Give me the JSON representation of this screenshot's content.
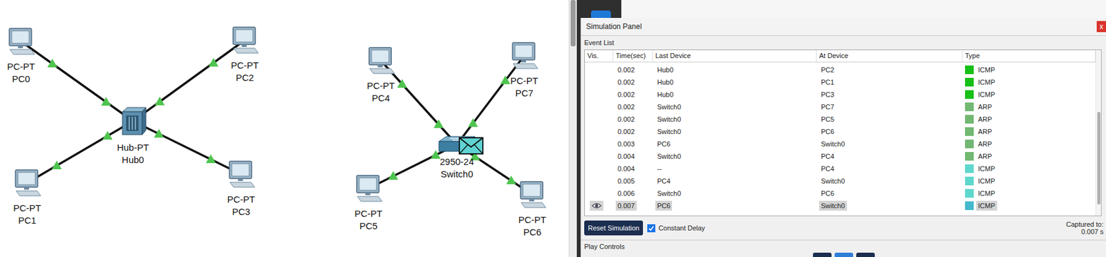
{
  "diagram": {
    "nodes": [
      {
        "name": "PC0",
        "model": "PC-PT",
        "kind": "pc"
      },
      {
        "name": "PC2",
        "model": "PC-PT",
        "kind": "pc"
      },
      {
        "name": "Hub0",
        "model": "Hub-PT",
        "kind": "hub"
      },
      {
        "name": "PC1",
        "model": "PC-PT",
        "kind": "pc"
      },
      {
        "name": "PC3",
        "model": "PC-PT",
        "kind": "pc"
      },
      {
        "name": "PC4",
        "model": "PC-PT",
        "kind": "pc"
      },
      {
        "name": "PC7",
        "model": "PC-PT",
        "kind": "pc"
      },
      {
        "name": "Switch0",
        "model": "2950-24",
        "kind": "switch"
      },
      {
        "name": "PC5",
        "model": "PC-PT",
        "kind": "pc"
      },
      {
        "name": "PC6",
        "model": "PC-PT",
        "kind": "pc"
      }
    ],
    "links": [
      {
        "from": "PC0",
        "to": "Hub0",
        "up": true
      },
      {
        "from": "PC2",
        "to": "Hub0",
        "up": true
      },
      {
        "from": "PC1",
        "to": "Hub0",
        "up": true
      },
      {
        "from": "PC3",
        "to": "Hub0",
        "up": true
      },
      {
        "from": "PC4",
        "to": "Switch0",
        "up": true
      },
      {
        "from": "PC7",
        "to": "Switch0",
        "up": true
      },
      {
        "from": "PC5",
        "to": "Switch0",
        "up": true
      },
      {
        "from": "PC6",
        "to": "Switch0",
        "up": true
      }
    ],
    "packet": {
      "at": "Switch0"
    }
  },
  "simulation_panel": {
    "title": "Simulation Panel",
    "close": "x",
    "event_list_label": "Event List",
    "columns": [
      "Vis.",
      "Time(sec)",
      "Last Device",
      "At Device",
      "Type"
    ],
    "rows": [
      {
        "visible": false,
        "time": "0.002",
        "last": "Hub0",
        "at": "PC2",
        "type": "ICMP",
        "color": "#16c016",
        "selected": false
      },
      {
        "visible": false,
        "time": "0.002",
        "last": "Hub0",
        "at": "PC1",
        "type": "ICMP",
        "color": "#16c016",
        "selected": false
      },
      {
        "visible": false,
        "time": "0.002",
        "last": "Hub0",
        "at": "PC3",
        "type": "ICMP",
        "color": "#16c016",
        "selected": false
      },
      {
        "visible": false,
        "time": "0.002",
        "last": "Switch0",
        "at": "PC7",
        "type": "ARP",
        "color": "#72b872",
        "selected": false
      },
      {
        "visible": false,
        "time": "0.002",
        "last": "Switch0",
        "at": "PC5",
        "type": "ARP",
        "color": "#72b872",
        "selected": false
      },
      {
        "visible": false,
        "time": "0.002",
        "last": "Switch0",
        "at": "PC6",
        "type": "ARP",
        "color": "#72b872",
        "selected": false
      },
      {
        "visible": false,
        "time": "0.003",
        "last": "PC6",
        "at": "Switch0",
        "type": "ARP",
        "color": "#72b872",
        "selected": false
      },
      {
        "visible": false,
        "time": "0.004",
        "last": "Switch0",
        "at": "PC4",
        "type": "ARP",
        "color": "#72b872",
        "selected": false
      },
      {
        "visible": false,
        "time": "0.004",
        "last": "--",
        "at": "PC4",
        "type": "ICMP",
        "color": "#5ed8cc",
        "selected": false
      },
      {
        "visible": false,
        "time": "0.005",
        "last": "PC4",
        "at": "Switch0",
        "type": "ICMP",
        "color": "#5ed8cc",
        "selected": false
      },
      {
        "visible": false,
        "time": "0.006",
        "last": "Switch0",
        "at": "PC6",
        "type": "ICMP",
        "color": "#5ed8cc",
        "selected": false
      },
      {
        "visible": true,
        "time": "0.007",
        "last": "PC6",
        "at": "Switch0",
        "type": "ICMP",
        "color": "#44b8cc",
        "selected": true
      }
    ],
    "reset_button": "Reset Simulation",
    "constant_delay": {
      "label": "Constant Delay",
      "checked": true
    },
    "captured_label": "Captured to:",
    "captured_value": "0.007 s",
    "play_controls_label": "Play Controls"
  }
}
